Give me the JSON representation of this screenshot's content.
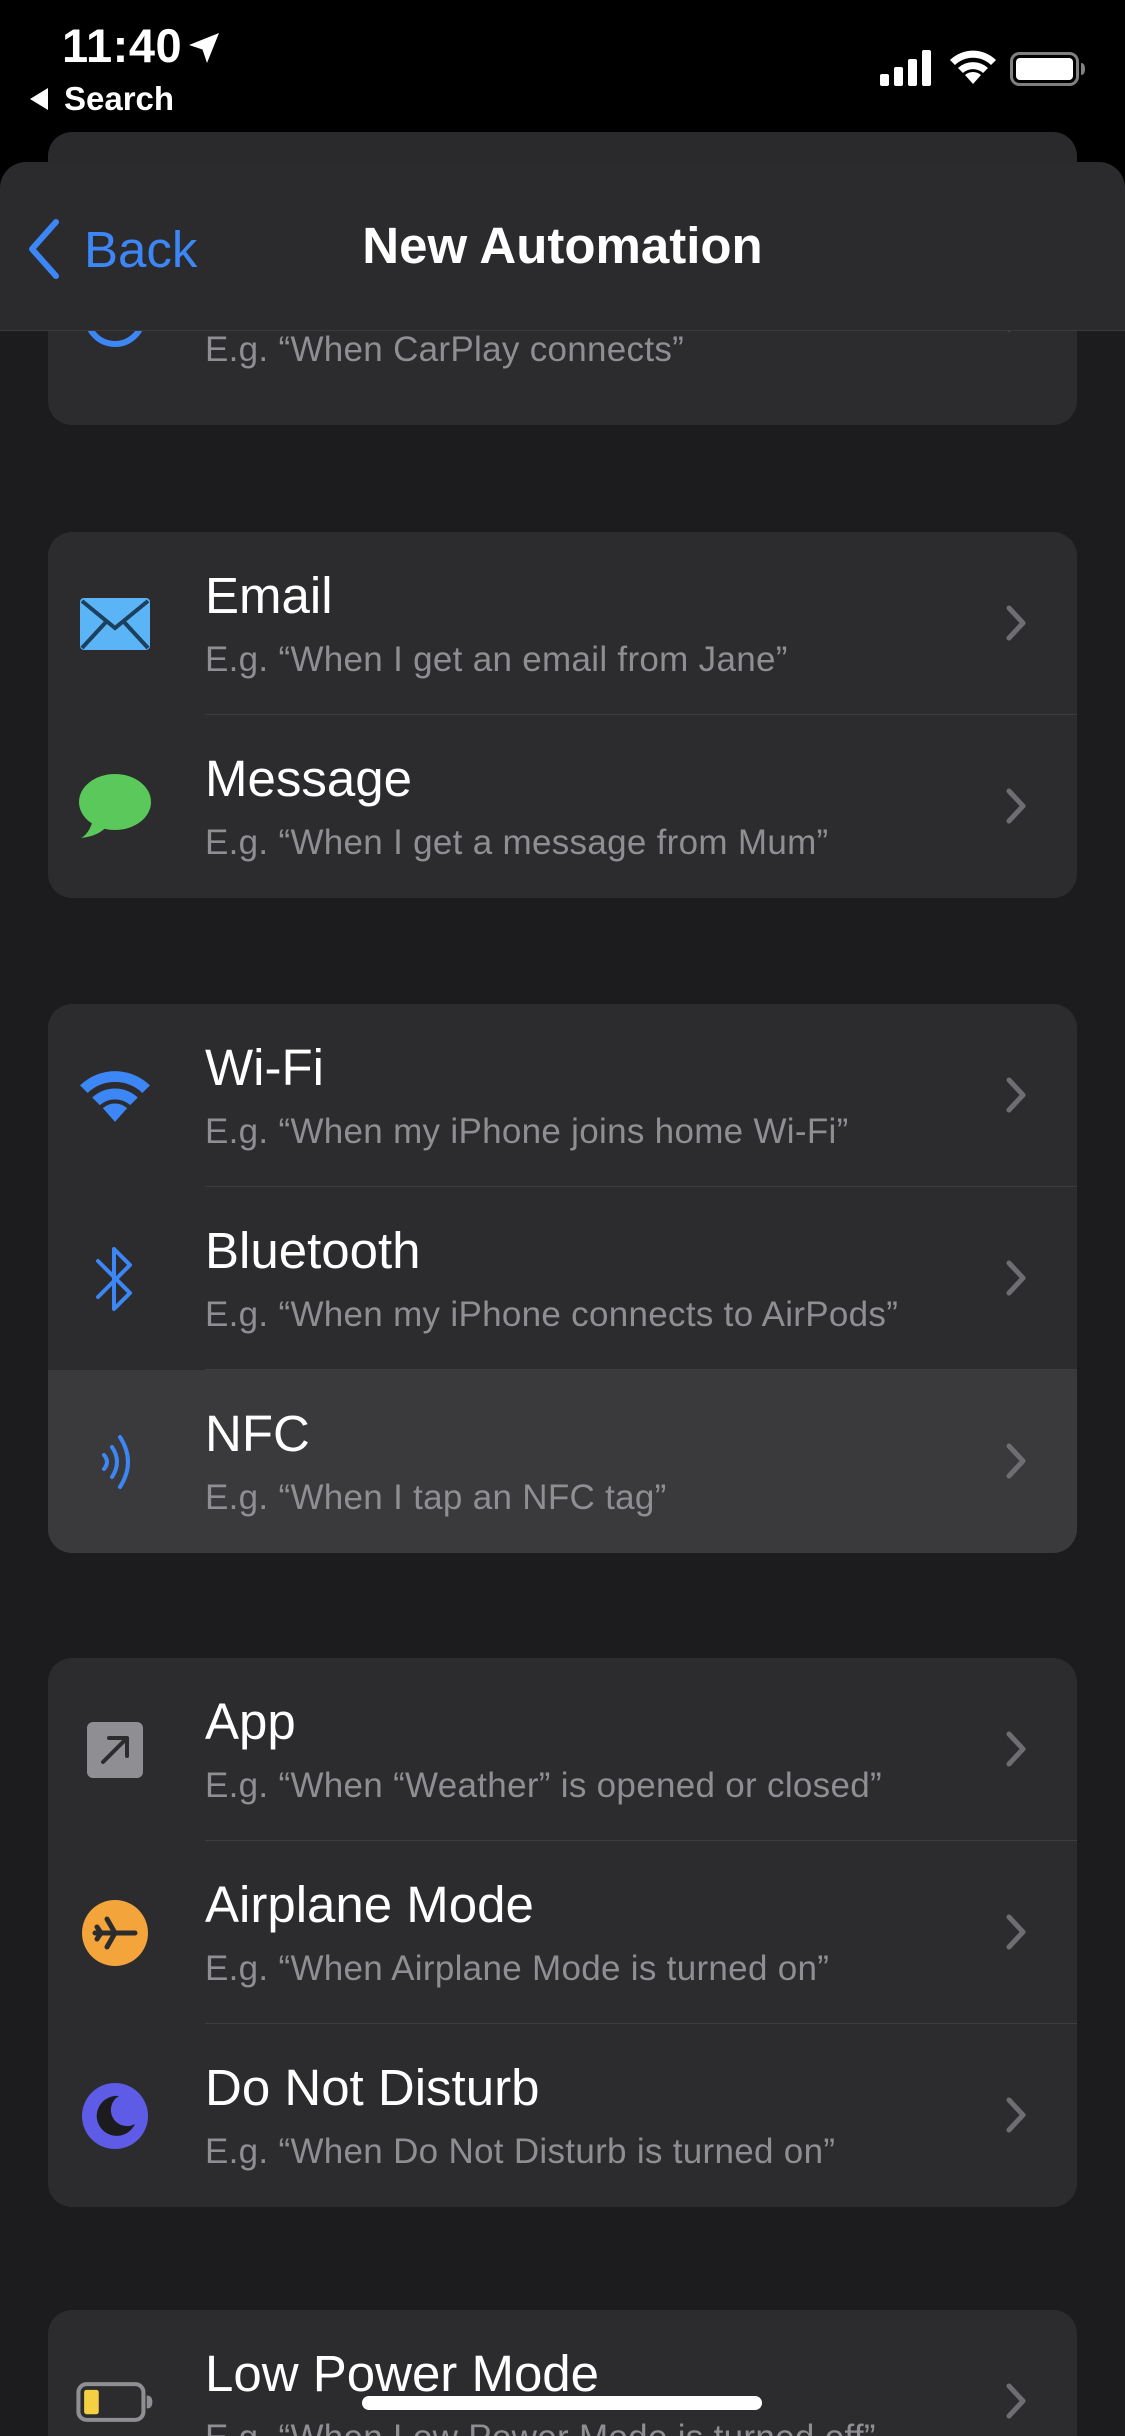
{
  "status_bar": {
    "time": "11:40",
    "back_label": "Search"
  },
  "nav": {
    "back_label": "Back",
    "title": "New Automation"
  },
  "groups": [
    {
      "rows": [
        {
          "title": "",
          "subtitle": "E.g. “When CarPlay connects”",
          "icon": "carplay-icon"
        }
      ]
    },
    {
      "rows": [
        {
          "title": "Email",
          "subtitle": "E.g. “When I get an email from Jane”",
          "icon": "envelope-icon"
        },
        {
          "title": "Message",
          "subtitle": "E.g. “When I get a message from Mum”",
          "icon": "message-bubble-icon"
        }
      ]
    },
    {
      "rows": [
        {
          "title": "Wi-Fi",
          "subtitle": "E.g. “When my iPhone joins home Wi-Fi”",
          "icon": "wifi-icon"
        },
        {
          "title": "Bluetooth",
          "subtitle": "E.g. “When my iPhone connects to AirPods”",
          "icon": "bluetooth-icon"
        },
        {
          "title": "NFC",
          "subtitle": "E.g. “When I tap an NFC tag”",
          "icon": "nfc-icon"
        }
      ]
    },
    {
      "rows": [
        {
          "title": "App",
          "subtitle": "E.g. “When “Weather” is opened or closed”",
          "icon": "app-arrow-icon"
        },
        {
          "title": "Airplane Mode",
          "subtitle": "E.g. “When Airplane Mode is turned on”",
          "icon": "airplane-icon"
        },
        {
          "title": "Do Not Disturb",
          "subtitle": "E.g. “When Do Not Disturb is turned on”",
          "icon": "moon-icon"
        }
      ]
    },
    {
      "rows": [
        {
          "title": "Low Power Mode",
          "subtitle": "E.g. “When Low Power Mode is turned off”",
          "icon": "low-battery-icon"
        }
      ]
    }
  ],
  "colors": {
    "accent": "#3d86f5",
    "message_green": "#5ac85a",
    "airplane_orange": "#f3a43b",
    "dnd_purple": "#5e5ce6",
    "email_blue": "#5ab4f5",
    "low_power_yellow": "#f5d042"
  }
}
